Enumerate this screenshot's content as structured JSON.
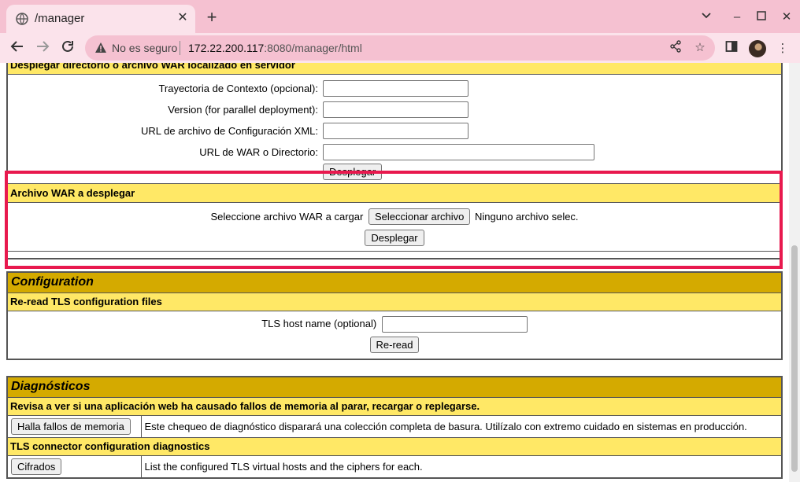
{
  "browser": {
    "tab_title": "/manager",
    "omnibox_security": "No es seguro",
    "url_host": "172.22.200.117",
    "url_rest": ":8080/manager/html"
  },
  "deploy_dir": {
    "section_title": "Desplegar directorio o archivo WAR localizado en servidor",
    "context_path_label": "Trayectoria de Contexto (opcional):",
    "version_label": "Version (for parallel deployment):",
    "config_url_label": "URL de archivo de Configuración XML:",
    "war_url_label": "URL de WAR o Directorio:",
    "deploy_button": "Desplegar"
  },
  "war_upload": {
    "section_title": "Archivo WAR a desplegar",
    "select_label": "Seleccione archivo WAR a cargar",
    "select_button": "Seleccionar archivo",
    "no_file_text": "Ninguno archivo selec.",
    "deploy_button": "Desplegar"
  },
  "configuration": {
    "title": "Configuration",
    "reread_title": "Re-read TLS configuration files",
    "tls_host_label": "TLS host name (optional)",
    "reread_button": "Re-read"
  },
  "diagnostics": {
    "title": "Diagnósticos",
    "leaks_title": "Revisa a ver si una aplicación web ha causado fallos de memoria al parar, recargar o replegarse.",
    "leaks_button": "Halla fallos de memoria",
    "leaks_desc": "Este chequeo de diagnóstico disparará una colección completa de basura. Utilízalo con extremo cuidado en sistemas en producción.",
    "tls_title": "TLS connector configuration diagnostics",
    "ciphers_button": "Cifrados",
    "ciphers_desc": "List the configured TLS virtual hosts and the ciphers for each."
  },
  "colors": {
    "title_bar": "#d4aa00",
    "subtitle_bar": "#ffe866",
    "highlight": "#e8194e",
    "chrome": "#f5c1d1"
  }
}
